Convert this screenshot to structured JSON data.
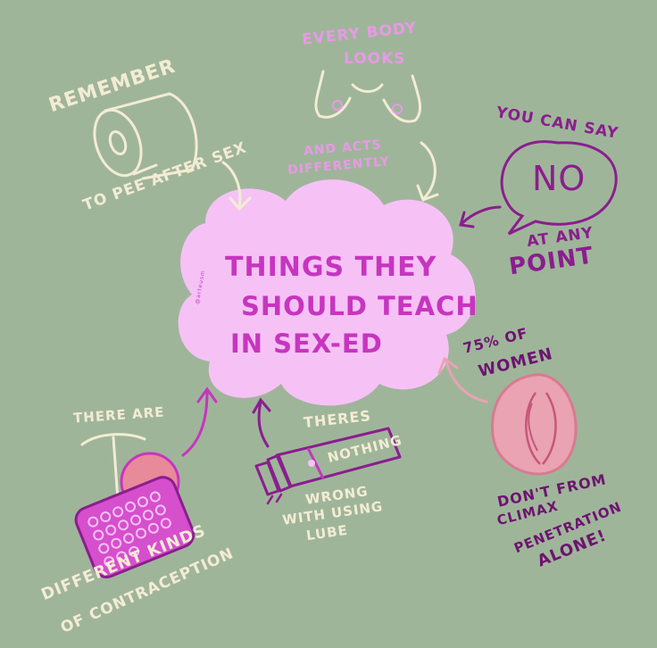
{
  "cloud": {
    "line1": "THINGS THEY",
    "line2": "SHOULD TEACH",
    "line3": "IN  SEX-ED",
    "tiny_mark": "@arteusm"
  },
  "tip_pee": {
    "top": "REMEMBER",
    "bottom": "TO PEE AFTER SEX"
  },
  "tip_body": {
    "top1": "EVERY BODY",
    "top2": "LOOKS",
    "bottom1": "AND ACTS",
    "bottom2": "DIFFERENTLY"
  },
  "tip_no": {
    "top": "YOU CAN SAY",
    "bubble": "NO",
    "bottom1": "AT ANY",
    "bottom2": "POINT"
  },
  "tip_women": {
    "top1": "75% OF",
    "top2": "WOMEN",
    "bottom1": "DON'T FROM",
    "bottom2": "CLIMAX",
    "bottom3": "PENETRATION",
    "bottom4": "ALONE!"
  },
  "tip_lube": {
    "top": "THERES",
    "tube": "NOTHING",
    "bottom1": "WRONG",
    "bottom2": "WITH USING",
    "bottom3": "LUBE"
  },
  "tip_contra": {
    "top": "THERE ARE",
    "bottom1": "DIFFERENT KINDS",
    "bottom2": "OF CONTRACEPTION"
  },
  "colors": {
    "background": "#9fb59a",
    "cloud_fill": "#f6c2f6",
    "cream": "#f3ecd4",
    "light_pink": "#e79ae5",
    "purple": "#8a1e8e",
    "magenta": "#c735bf"
  }
}
